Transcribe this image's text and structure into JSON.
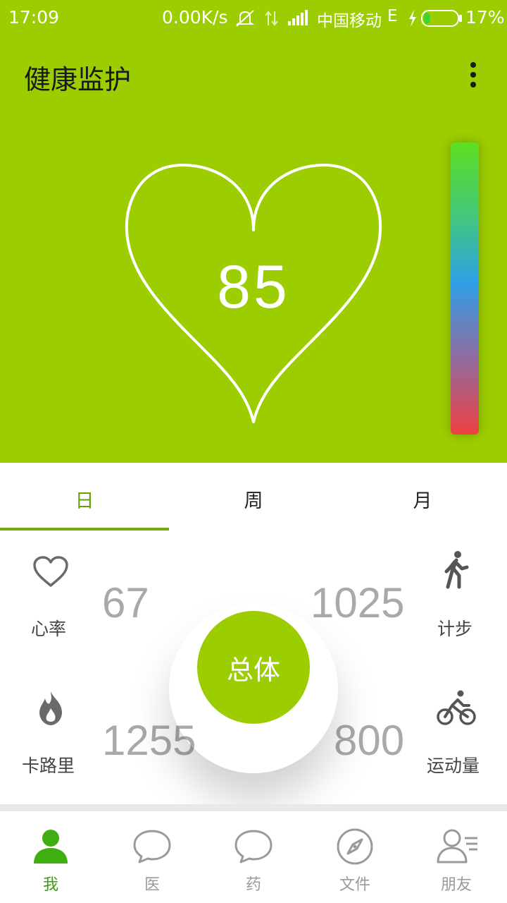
{
  "status_bar": {
    "time": "17:09",
    "net_speed": "0.00K/s",
    "carrier": "中国移动",
    "network_type": "E",
    "battery_percent": "17%",
    "battery_level": 0.17
  },
  "app_bar": {
    "title": "健康监护",
    "overflow_icon": "more-vert-icon"
  },
  "hero": {
    "score": "85",
    "heart_icon": "heart-outline"
  },
  "tabs": [
    {
      "label": "日",
      "active": true
    },
    {
      "label": "周",
      "active": false
    },
    {
      "label": "月",
      "active": false
    }
  ],
  "stats": {
    "heart_rate": {
      "label": "心率",
      "value": "67",
      "icon": "heart-icon"
    },
    "steps": {
      "label": "计步",
      "value": "1025",
      "icon": "walking-icon"
    },
    "calories": {
      "label": "卡路里",
      "value": "1255",
      "icon": "flame-icon"
    },
    "exercise": {
      "label": "运动量",
      "value": "800",
      "icon": "bicycle-icon"
    },
    "overall_button": "总体"
  },
  "bottom_nav": [
    {
      "label": "我",
      "icon": "person-icon",
      "active": true
    },
    {
      "label": "医",
      "icon": "chat-bubble-icon",
      "active": false
    },
    {
      "label": "药",
      "icon": "chat-bubble-icon",
      "active": false
    },
    {
      "label": "文件",
      "icon": "compass-icon",
      "active": false
    },
    {
      "label": "朋友",
      "icon": "contacts-icon",
      "active": false
    }
  ],
  "colors": {
    "primary": "#9ccd01",
    "tab_active": "#6b9d0a",
    "nav_active": "#3c9d10",
    "stat_value": "#a9a9a9"
  }
}
